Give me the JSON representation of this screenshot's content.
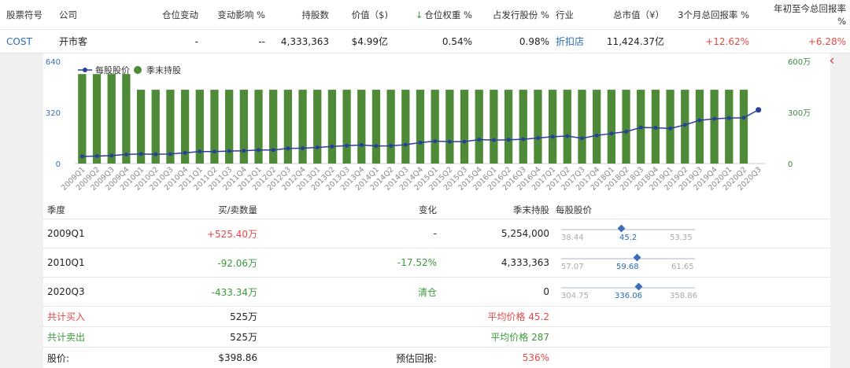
{
  "header": {
    "columns": [
      "股票符号",
      "公司",
      "仓位变动",
      "变动影响 %",
      "持股数",
      "价值（$)",
      "仓位权重 %",
      "占发行股份 %",
      "行业",
      "总市值（¥）",
      "3个月总回报率 %",
      "年初至今总回报率 %"
    ],
    "sort_arrow": "↓"
  },
  "stock": {
    "symbol": "COST",
    "company": "开市客",
    "position_change": "-",
    "change_impact": "--",
    "shares": "4,333,363",
    "value": "$4.99亿",
    "weight": "0.54%",
    "pct_outstanding": "0.98%",
    "industry": "折扣店",
    "market_cap": "11,424.37亿",
    "return_3m": "+12.62%",
    "return_ytd": "+6.28%"
  },
  "close_label": "✕",
  "chart_data": {
    "type": "bar",
    "legend": [
      "每股股价",
      "季末持股"
    ],
    "categories": [
      "2009Q1",
      "2009Q2",
      "2009Q3",
      "2009Q4",
      "2010Q1",
      "2010Q2",
      "2010Q3",
      "2010Q4",
      "2011Q1",
      "2011Q2",
      "2011Q3",
      "2011Q4",
      "2012Q1",
      "2012Q2",
      "2012Q3",
      "2012Q4",
      "2013Q1",
      "2013Q2",
      "2013Q3",
      "2013Q4",
      "2014Q1",
      "2014Q2",
      "2014Q3",
      "2014Q4",
      "2015Q1",
      "2015Q2",
      "2015Q3",
      "2015Q4",
      "2016Q1",
      "2016Q2",
      "2016Q3",
      "2016Q4",
      "2017Q1",
      "2017Q2",
      "2017Q3",
      "2017Q4",
      "2018Q1",
      "2018Q2",
      "2018Q3",
      "2018Q4",
      "2019Q1",
      "2019Q2",
      "2019Q3",
      "2019Q4",
      "2020Q1",
      "2020Q2",
      "2020Q3"
    ],
    "series": [
      {
        "name": "季末持股",
        "axis": "right",
        "values": [
          5254000,
          5254000,
          5254000,
          5254000,
          4333363,
          4333363,
          4333363,
          4333363,
          4333363,
          4333363,
          4333363,
          4333363,
          4333363,
          4333363,
          4333363,
          4333363,
          4333363,
          4333363,
          4333363,
          4333363,
          4333363,
          4333363,
          4333363,
          4333363,
          4333363,
          4333363,
          4333363,
          4333363,
          4333363,
          4333363,
          4333363,
          4333363,
          4333363,
          4333363,
          4333363,
          4333363,
          4333363,
          4333363,
          4333363,
          4333363,
          4333363,
          4333363,
          4333363,
          4333363,
          4333363,
          4333363,
          0
        ]
      },
      {
        "name": "每股股价",
        "axis": "left",
        "values": [
          45.2,
          47,
          50,
          57,
          59.68,
          58,
          60,
          67,
          75,
          75,
          78,
          80,
          85,
          85,
          95,
          96,
          101,
          107,
          112,
          116,
          110,
          111,
          118,
          131,
          140,
          137,
          137,
          150,
          147,
          149,
          152,
          160,
          168,
          172,
          158,
          176,
          188,
          200,
          226,
          224,
          220,
          242,
          271,
          280,
          285,
          287,
          336.06
        ]
      }
    ],
    "ylim_left": [
      0,
      640
    ],
    "ylim_right": [
      0,
      6000000
    ],
    "left_ticks": [
      "640",
      "320",
      "0"
    ],
    "right_ticks": [
      "600万",
      "300万",
      "0"
    ]
  },
  "detail": {
    "headers": [
      "季度",
      "买/卖数量",
      "变化",
      "季末持股",
      "每股股价"
    ],
    "rows": [
      {
        "quarter": "2009Q1",
        "qty": "+525.40万",
        "change": "-",
        "hold": "5,254,000",
        "low": "38.44",
        "price": "45.2",
        "high": "53.35",
        "frac": 0.45
      },
      {
        "quarter": "2010Q1",
        "qty": "-92.06万",
        "change": "-17.52%",
        "hold": "4,333,363",
        "low": "57.07",
        "price": "59.68",
        "high": "61.65",
        "frac": 0.57
      },
      {
        "quarter": "2020Q3",
        "qty": "-433.34万",
        "change": "清仓",
        "hold": "0",
        "low": "304.75",
        "price": "336.06",
        "high": "358.86",
        "frac": 0.58
      }
    ],
    "total_buy_label": "共计买入",
    "total_buy": "525万",
    "avg_buy": "平均价格 45.2",
    "total_sell_label": "共计卖出",
    "total_sell": "525万",
    "avg_sell": "平均价格 287",
    "price_label": "股价:",
    "price_value": "$398.86",
    "est_return_label": "预估回报:",
    "est_return_value": "536%"
  }
}
